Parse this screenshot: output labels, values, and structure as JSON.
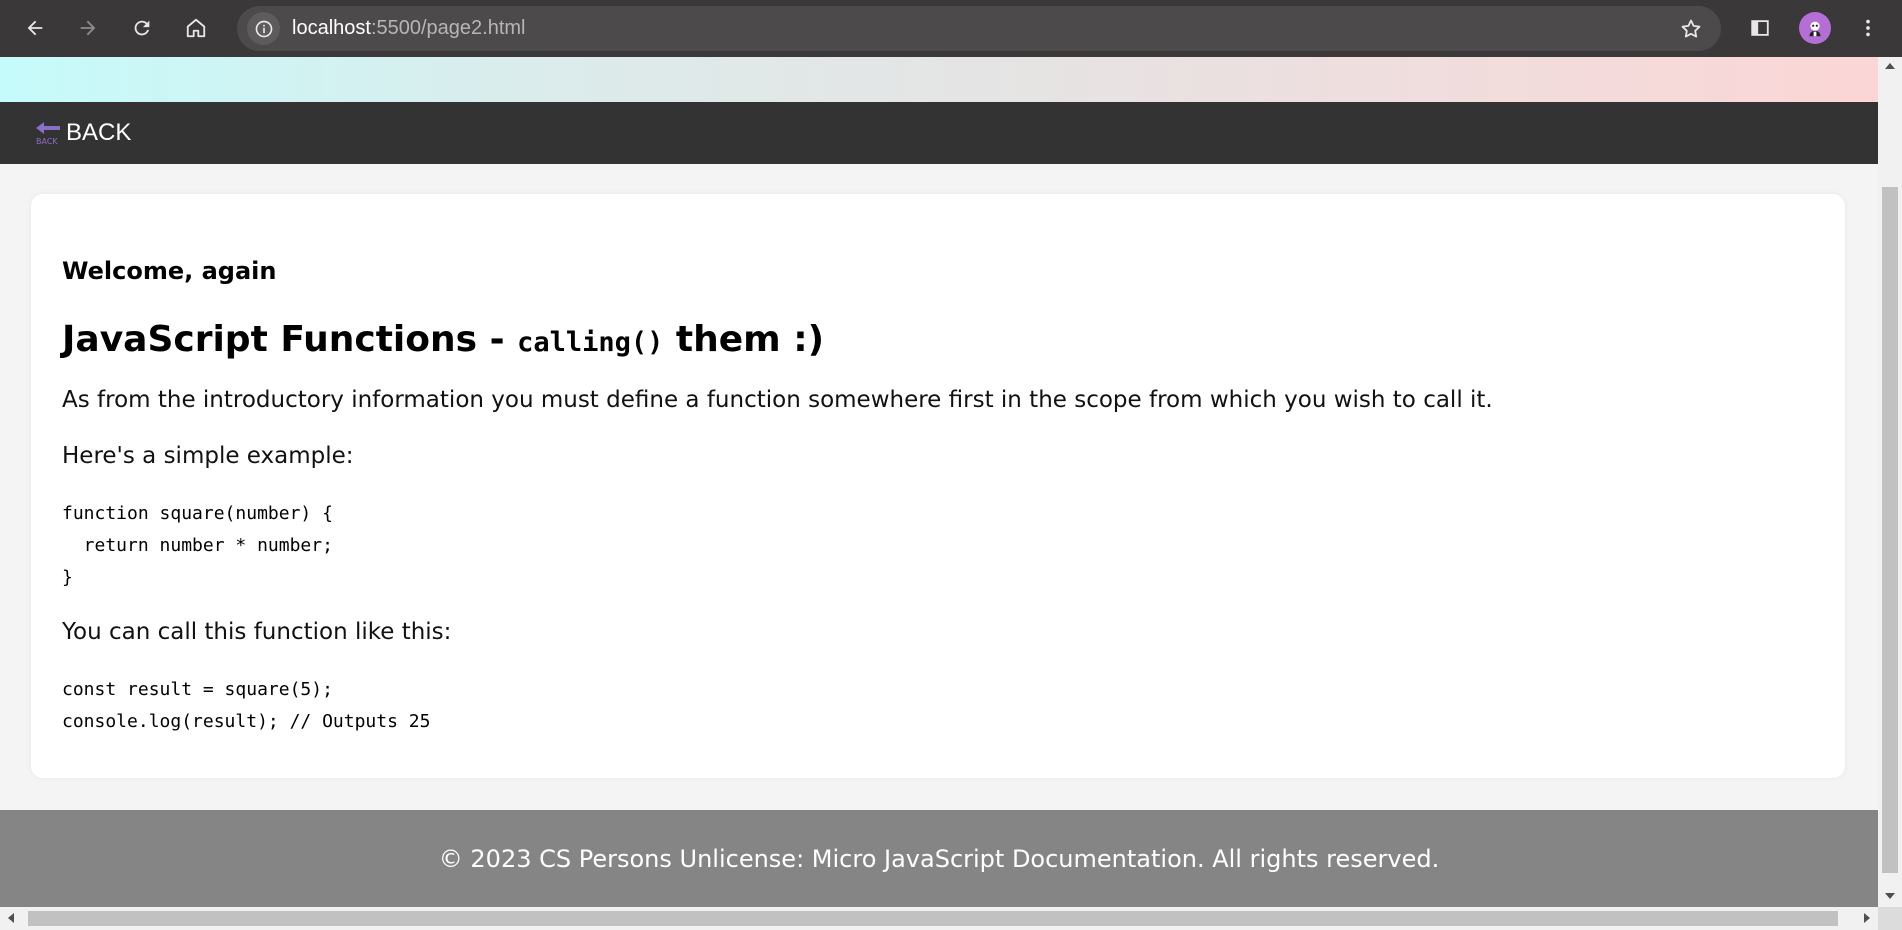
{
  "browser": {
    "url_host": "localhost",
    "url_path": ":5500/page2.html",
    "back_icon": "arrow-left-icon",
    "forward_icon": "arrow-right-icon",
    "reload_icon": "reload-icon",
    "home_icon": "home-icon",
    "info_icon": "info-icon",
    "star_icon": "star-icon",
    "sidepanel_icon": "side-panel-icon",
    "menu_icon": "kebab-menu-icon"
  },
  "nav": {
    "back_label": "BACK",
    "back_icon_text": "BACK"
  },
  "content": {
    "welcome": "Welcome, again",
    "heading_prefix": "JavaScript Functions - ",
    "heading_code": "calling()",
    "heading_suffix": " them :)",
    "intro": "As from the introductory information you must define a function somewhere first in the scope from which you wish to call it.",
    "example_label": "Here's a simple example:",
    "code_example": "function square(number) {\n  return number * number;\n}",
    "call_label": "You can call this function like this:",
    "code_call": "const result = square(5);\nconsole.log(result); // Outputs 25"
  },
  "footer": {
    "text": "© 2023 CS Persons Unlicense: Micro JavaScript Documentation. All rights reserved."
  },
  "colors": {
    "navbar": "#333333",
    "footer": "#858585",
    "back_icon": "#8a6fc6"
  }
}
